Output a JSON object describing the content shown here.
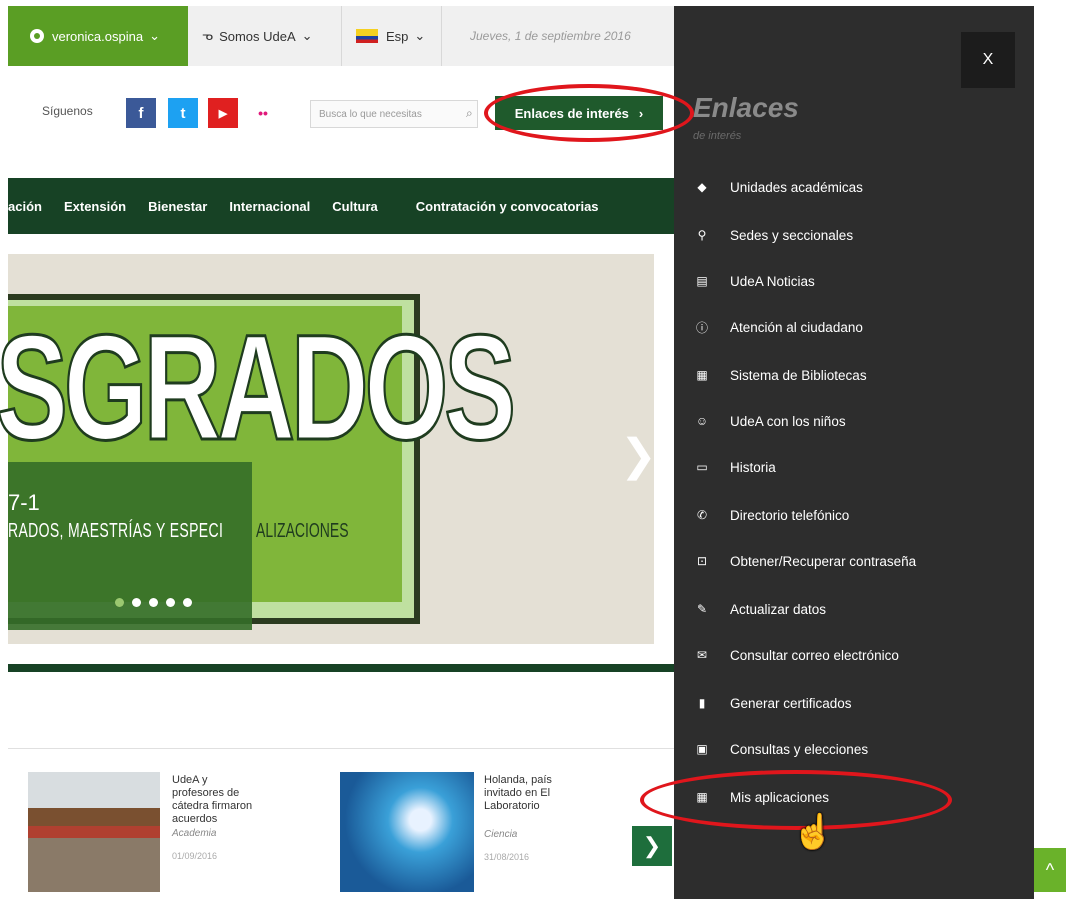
{
  "topbar": {
    "user": "veronica.ospina",
    "somos": "Somos UdeA",
    "lang": "Esp",
    "date": "Jueves, 1 de septiembre 2016"
  },
  "social": {
    "siguenos": "Síguenos",
    "facebook": "f",
    "twitter": "t",
    "youtube": "▶",
    "flickr": "••"
  },
  "search": {
    "placeholder": "Busca lo que necesitas"
  },
  "enlaces_button": "Enlaces de interés",
  "nav": {
    "items": [
      "ación",
      "Extensión",
      "Bienestar",
      "Internacional",
      "Cultura",
      "Contratación y convocatorias"
    ]
  },
  "banner": {
    "title": "SGRADOS",
    "year": "7-1",
    "subtitle_left": "RADOS, MAESTRÍAS Y ESPECI",
    "subtitle_right": "ALIZACIONES",
    "next_arrow": "❯"
  },
  "news": [
    {
      "title_lines": [
        "UdeA y",
        "profesores de",
        "cátedra firmaron",
        "acuerdos"
      ],
      "category": "Academia",
      "date": "01/09/2016"
    },
    {
      "title_lines": [
        "Holanda, país",
        "invitado en El",
        "Laboratorio"
      ],
      "category": "Ciencia",
      "date": "31/08/2016"
    }
  ],
  "news_next": "❯",
  "scroll_top": "^",
  "panel": {
    "close": "X",
    "title": "Enlaces",
    "subtitle": "de interés",
    "items": [
      {
        "label": "Unidades académicas",
        "icon": "tag"
      },
      {
        "label": "Sedes y seccionales",
        "icon": "map-pin"
      },
      {
        "label": "UdeA Noticias",
        "icon": "newspaper"
      },
      {
        "label": "Atención al ciudadano",
        "icon": "info-circle"
      },
      {
        "label": "Sistema de Bibliotecas",
        "icon": "grid"
      },
      {
        "label": "UdeA con los niños",
        "icon": "smile"
      },
      {
        "label": "Historia",
        "icon": "scroll"
      },
      {
        "label": "Directorio telefónico",
        "icon": "phone"
      },
      {
        "label": "Obtener/Recuperar contraseña",
        "icon": "lock"
      },
      {
        "label": "Actualizar datos",
        "icon": "pencil"
      },
      {
        "label": "Consultar correo electrónico",
        "icon": "envelope"
      },
      {
        "label": "Generar certificados",
        "icon": "document"
      },
      {
        "label": "Consultas y elecciones",
        "icon": "ballot"
      },
      {
        "label": "Mis aplicaciones",
        "icon": "apps-grid"
      }
    ]
  }
}
